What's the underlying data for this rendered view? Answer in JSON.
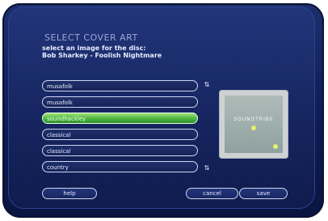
{
  "dialog": {
    "title": "SELECT COVER ART",
    "prompt_line1": "select an image for the disc:",
    "prompt_line2": "Bob Sharkey - Foolish Nightmare"
  },
  "list": {
    "items": [
      {
        "label": "musafolk",
        "selected": false
      },
      {
        "label": "musafolk",
        "selected": false
      },
      {
        "label": "soundhackley",
        "selected": true
      },
      {
        "label": "classical",
        "selected": false
      },
      {
        "label": "classical",
        "selected": false
      },
      {
        "label": "country",
        "selected": false
      }
    ],
    "scroll_up_icon": "scroll-arrow-up-icon",
    "scroll_down_icon": "scroll-arrow-down-icon"
  },
  "cover_preview": {
    "text": "SOUNDTRIBE"
  },
  "buttons": {
    "help": "help",
    "cancel": "cancel",
    "save": "save"
  },
  "colors": {
    "bezel": "#0f1c52",
    "screen": "#15245e",
    "selected_item": "#4db43f",
    "pill_border": "#cfd6f0"
  }
}
